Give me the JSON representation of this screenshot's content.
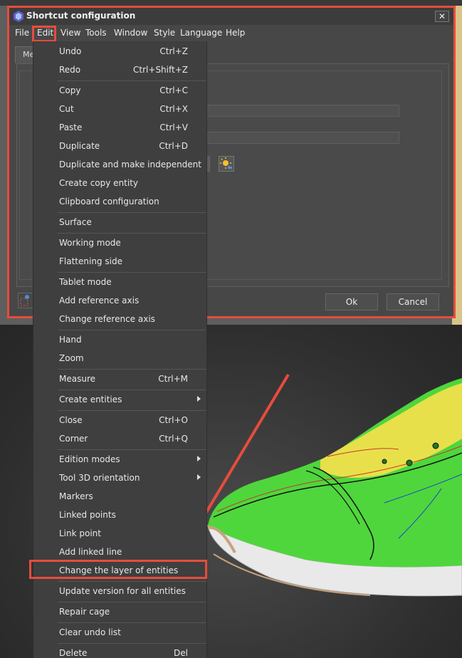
{
  "dialog": {
    "title": "Shortcut configuration",
    "close_label": "✕",
    "tab_label": "Me",
    "ok_label": "Ok",
    "cancel_label": "Cancel"
  },
  "menubar": {
    "items": [
      "File",
      "Edit",
      "View",
      "Tools",
      "Window",
      "Style",
      "Language",
      "Help"
    ]
  },
  "edit_menu": {
    "items": [
      {
        "label": "Undo",
        "shortcut": "Ctrl+Z"
      },
      {
        "label": "Redo",
        "shortcut": "Ctrl+Shift+Z"
      },
      {
        "label": "Copy",
        "shortcut": "Ctrl+C"
      },
      {
        "label": "Cut",
        "shortcut": "Ctrl+X"
      },
      {
        "label": "Paste",
        "shortcut": "Ctrl+V"
      },
      {
        "label": "Duplicate",
        "shortcut": "Ctrl+D"
      },
      {
        "label": "Duplicate and make independent",
        "shortcut": ""
      },
      {
        "label": "Create copy entity",
        "shortcut": ""
      },
      {
        "label": "Clipboard configuration",
        "shortcut": ""
      },
      {
        "label": "Surface",
        "shortcut": ""
      },
      {
        "label": "Working mode",
        "shortcut": ""
      },
      {
        "label": "Flattening side",
        "shortcut": ""
      },
      {
        "label": "Tablet mode",
        "shortcut": ""
      },
      {
        "label": "Add reference axis",
        "shortcut": ""
      },
      {
        "label": "Change reference axis",
        "shortcut": ""
      },
      {
        "label": "Hand",
        "shortcut": ""
      },
      {
        "label": "Zoom",
        "shortcut": ""
      },
      {
        "label": "Measure",
        "shortcut": "Ctrl+M"
      },
      {
        "label": "Create entities",
        "shortcut": "",
        "submenu": true
      },
      {
        "label": "Close",
        "shortcut": "Ctrl+O"
      },
      {
        "label": "Corner",
        "shortcut": "Ctrl+Q"
      },
      {
        "label": "Edition modes",
        "shortcut": "",
        "submenu": true
      },
      {
        "label": "Tool 3D orientation",
        "shortcut": "",
        "submenu": true
      },
      {
        "label": "Markers",
        "shortcut": ""
      },
      {
        "label": "Linked points",
        "shortcut": ""
      },
      {
        "label": "Link point",
        "shortcut": ""
      },
      {
        "label": "Add linked line",
        "shortcut": ""
      },
      {
        "label": "Change the layer of entities",
        "shortcut": "",
        "highlighted": true
      },
      {
        "label": "Update version for all entities",
        "shortcut": ""
      },
      {
        "label": "Repair cage",
        "shortcut": ""
      },
      {
        "label": "Clear undo list",
        "shortcut": ""
      },
      {
        "label": "Delete",
        "shortcut": "Del"
      }
    ]
  },
  "colors": {
    "highlight_red": "#e74c3c",
    "menu_bg": "#3f3f3f",
    "shoe_green": "#4fd63c",
    "shoe_yellow": "#e8e04a"
  }
}
